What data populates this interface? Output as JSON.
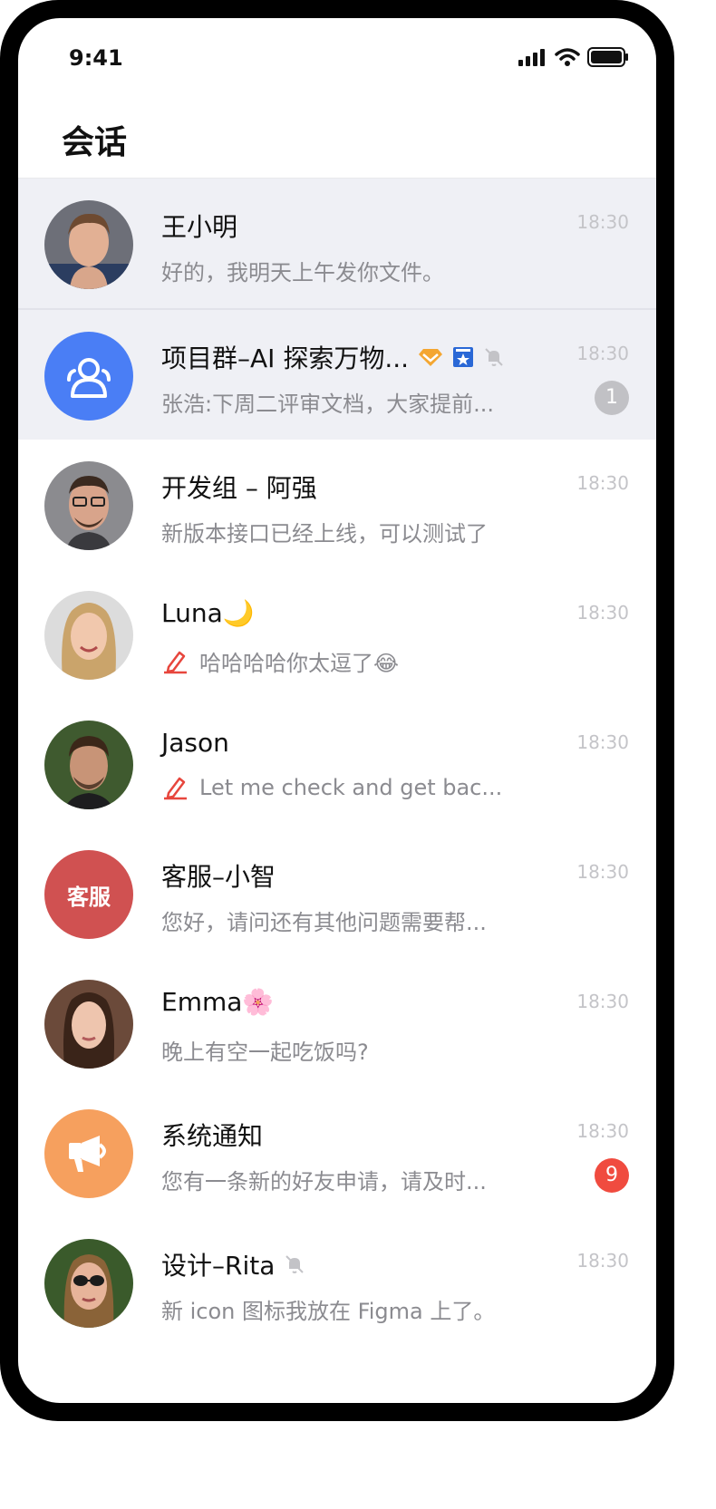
{
  "status_bar": {
    "time": "9:41"
  },
  "header": {
    "title": "会话"
  },
  "conversations": [
    {
      "name": "王小明",
      "preview": "好的，我明天上午发你文件。",
      "time": "18:30",
      "pinned": true,
      "avatar": "photo-man-1"
    },
    {
      "name": "项目群–AI 探索万物...",
      "preview": "张浩:下周二评审文档，大家提前...",
      "time": "18:30",
      "pinned": true,
      "badge": "1",
      "avatar": "group-icon",
      "avatar_color": "#4a7ef5",
      "tag_icons": [
        "diamond-icon",
        "star-bookmark-icon",
        "mute-bell-icon"
      ]
    },
    {
      "name": "开发组 – 阿强",
      "preview": "新版本接口已经上线，可以测试了",
      "time": "18:30",
      "avatar": "photo-man-glasses"
    },
    {
      "name": "Luna🌙",
      "preview": "哈哈哈哈你太逗了😂",
      "time": "18:30",
      "avatar": "photo-woman-blonde",
      "draft": true
    },
    {
      "name": "Jason",
      "preview": "Let me check and get bac...",
      "time": "18:30",
      "avatar": "photo-man-2",
      "draft": true
    },
    {
      "name": "客服–小智",
      "preview": "您好，请问还有其他问题需要帮...",
      "time": "18:30",
      "avatar_label": "客服",
      "avatar_color": "#d05151"
    },
    {
      "name": "Emma🌸",
      "preview": "晚上有空一起吃饭吗?",
      "time": "18:30",
      "avatar": "photo-woman-brunette"
    },
    {
      "name": "系统通知",
      "preview": "您有一条新的好友申请，请及时...",
      "time": "18:30",
      "badge": "9",
      "avatar": "megaphone-icon",
      "avatar_color": "#f6a05e"
    },
    {
      "name": "设计–Rita",
      "preview": "新 icon 图标我放在 Figma 上了。",
      "time": "18:30",
      "avatar": "photo-woman-sunglasses",
      "muted": true
    }
  ]
}
